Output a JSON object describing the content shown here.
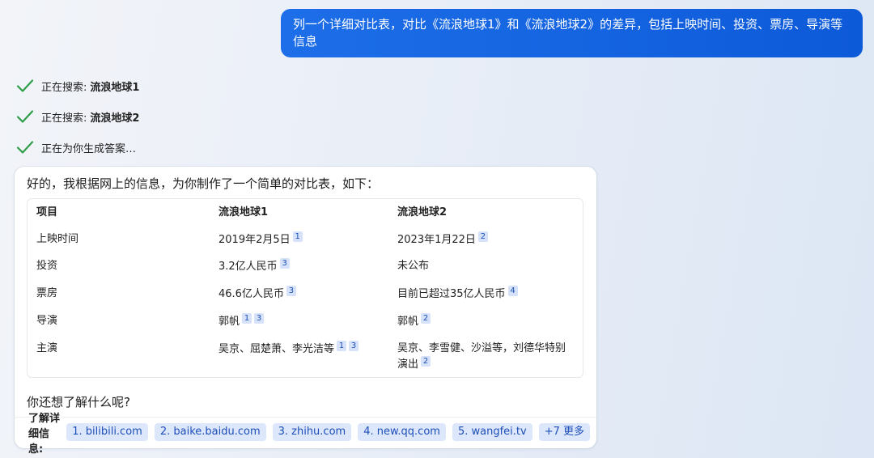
{
  "user_message": "列一个详细对比表，对比《流浪地球1》和《流浪地球2》的差异，包括上映时间、投资、票房、导演等信息",
  "search_steps": [
    {
      "prefix": "正在搜索:",
      "term": "流浪地球1"
    },
    {
      "prefix": "正在搜索:",
      "term": "流浪地球2"
    },
    {
      "prefix": "正在为你生成答案…",
      "term": ""
    }
  ],
  "answer": {
    "intro": "好的，我根据网上的信息，为你制作了一个简单的对比表，如下：",
    "table": {
      "headers": [
        "项目",
        "流浪地球1",
        "流浪地球2"
      ],
      "rows": [
        {
          "label": "上映时间",
          "c1": "2019年2月5日",
          "c1_cites": [
            "1"
          ],
          "c2": "2023年1月22日",
          "c2_cites": [
            "2"
          ]
        },
        {
          "label": "投资",
          "c1": "3.2亿人民币",
          "c1_cites": [
            "3"
          ],
          "c2": "未公布",
          "c2_cites": []
        },
        {
          "label": "票房",
          "c1": "46.6亿人民币",
          "c1_cites": [
            "3"
          ],
          "c2": "目前已超过35亿人民币",
          "c2_cites": [
            "4"
          ]
        },
        {
          "label": "导演",
          "c1": "郭帆",
          "c1_cites": [
            "1",
            "3"
          ],
          "c2": "郭帆",
          "c2_cites": [
            "2"
          ]
        },
        {
          "label": "主演",
          "c1": "吴京、屈楚萧、李光洁等",
          "c1_cites": [
            "1",
            "3"
          ],
          "c2_line1": "吴京、李雪健、沙溢等，刘德华特别",
          "c2_line2": "演出",
          "c2_cites": [
            "2"
          ]
        }
      ]
    },
    "followup": "你还想了解什么呢?",
    "learn_more": {
      "label": "了解详细信息:",
      "sources": [
        "1. bilibili.com",
        "2. baike.baidu.com",
        "3. zhihu.com",
        "4. new.qq.com",
        "5. wangfei.tv",
        "+7 更多"
      ]
    }
  },
  "colors": {
    "user_bubble": "#0d5ad9",
    "check": "#2e9e4a",
    "chip_bg": "#dde7fb",
    "chip_text": "#1d4fb8"
  },
  "icons": [
    "checkmark-icon"
  ]
}
